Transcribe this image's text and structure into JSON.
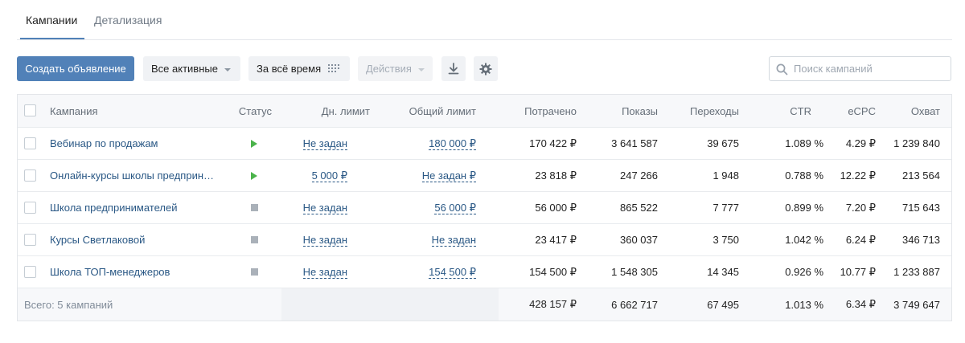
{
  "tabs": [
    {
      "label": "Кампании",
      "active": true
    },
    {
      "label": "Детализация",
      "active": false
    }
  ],
  "toolbar": {
    "create_label": "Создать объявление",
    "filter_label": "Все активные",
    "period_label": "За всё время",
    "actions_label": "Действия",
    "search_placeholder": "Поиск кампаний"
  },
  "table": {
    "headers": {
      "campaign": "Кампания",
      "status": "Статус",
      "day_limit": "Дн. лимит",
      "total_limit": "Общий лимит",
      "spent": "Потрачено",
      "impressions": "Показы",
      "clicks": "Переходы",
      "ctr": "CTR",
      "ecpc": "eCPC",
      "reach": "Охват"
    },
    "rows": [
      {
        "name": "Вебинар по продажам",
        "status": "play",
        "day_limit": "Не задан",
        "total_limit": "180 000 ₽",
        "spent": "170 422 ₽",
        "impressions": "3 641 587",
        "clicks": "39 675",
        "ctr": "1.089 %",
        "ecpc": "4.29 ₽",
        "reach": "1 239 840"
      },
      {
        "name": "Онлайн-курсы школы предприн…",
        "status": "play",
        "day_limit": "5 000 ₽",
        "total_limit": "Не задан ₽",
        "spent": "23 818 ₽",
        "impressions": "247 266",
        "clicks": "1 948",
        "ctr": "0.788 %",
        "ecpc": "12.22 ₽",
        "reach": "213 564"
      },
      {
        "name": "Школа предпринимателей",
        "status": "stop",
        "day_limit": "Не задан",
        "total_limit": "56 000 ₽",
        "spent": "56 000 ₽",
        "impressions": "865 522",
        "clicks": "7 777",
        "ctr": "0.899 %",
        "ecpc": "7.20 ₽",
        "reach": "715 643"
      },
      {
        "name": "Курсы Светлаковой",
        "status": "stop",
        "day_limit": "Не задан",
        "total_limit": "Не задан",
        "spent": "23 417 ₽",
        "impressions": "360 037",
        "clicks": "3 750",
        "ctr": "1.042 %",
        "ecpc": "6.24 ₽",
        "reach": "346 713"
      },
      {
        "name": "Школа ТОП-менеджеров",
        "status": "stop",
        "day_limit": "Не задан",
        "total_limit": "154 500 ₽",
        "spent": "154 500 ₽",
        "impressions": "1 548 305",
        "clicks": "14 345",
        "ctr": "0.926 %",
        "ecpc": "10.77 ₽",
        "reach": "1 233 887"
      }
    ],
    "footer": {
      "label": "Всего: 5 кампаний",
      "spent": "428 157 ₽",
      "impressions": "6 662 717",
      "clicks": "67 495",
      "ctr": "1.013 %",
      "ecpc": "6.34 ₽",
      "reach": "3 749 647"
    }
  },
  "colors": {
    "accent": "#5181b8",
    "link": "#2a5885",
    "status_active": "#4bb34b",
    "status_stopped": "#aab1b9"
  },
  "icons": {
    "period": "grid-dots-icon",
    "download": "download-icon",
    "settings": "gear-icon",
    "search": "search-icon"
  }
}
